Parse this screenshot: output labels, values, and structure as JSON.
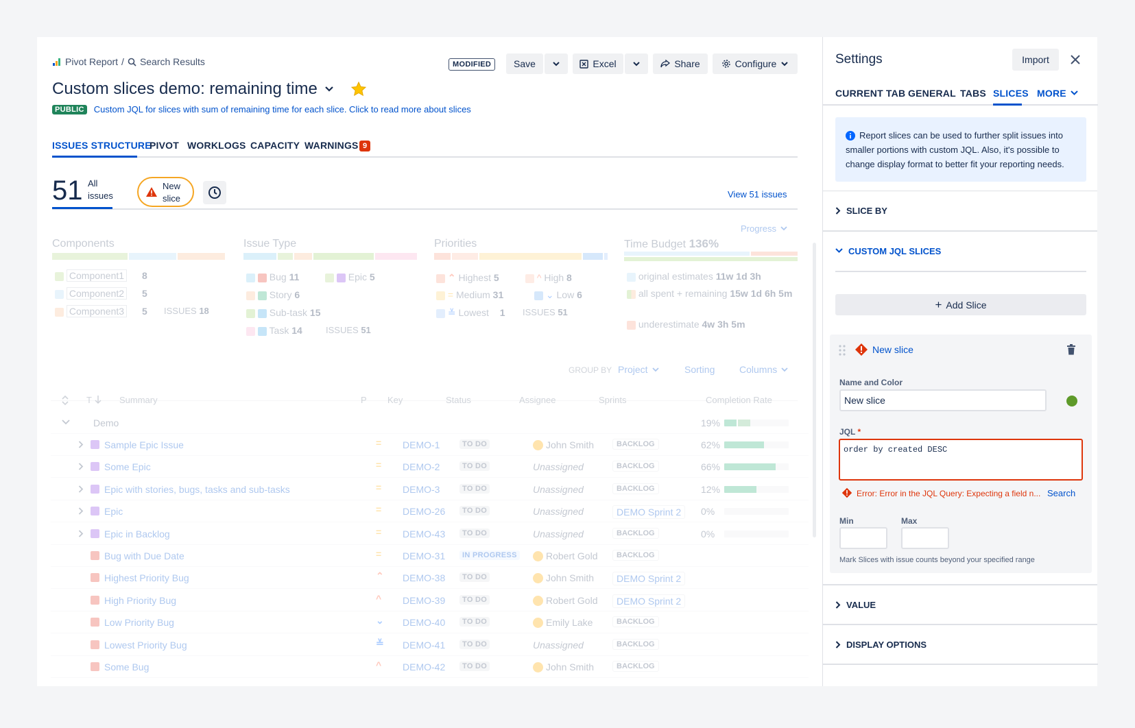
{
  "header": {
    "breadcrumb_app": "Pivot Report",
    "breadcrumb_sep": "/",
    "breadcrumb_search": "Search Results",
    "modified_badge": "MODIFIED",
    "save": "Save",
    "excel": "Excel",
    "share": "Share",
    "configure": "Configure",
    "title": "Custom slices demo: remaining time",
    "public_badge": "PUBLIC",
    "description": "Custom JQL for slices with sum of remaining time for each slice. Click to read more about slices"
  },
  "tabs": [
    {
      "label": "ISSUES STRUCTURE",
      "active": true
    },
    {
      "label": "PIVOT"
    },
    {
      "label": "WORKLOGS"
    },
    {
      "label": "CAPACITY"
    },
    {
      "label": "WARNINGS",
      "badge": "9"
    }
  ],
  "slices_bar": {
    "count": "51",
    "all_label_1": "All",
    "all_label_2": "issues",
    "new_slice_1": "New",
    "new_slice_2": "slice",
    "view_issues": "View 51 issues"
  },
  "widgets": {
    "progress_label": "Progress",
    "components": {
      "title": "Components",
      "items": [
        {
          "name": "Component1",
          "count": "8",
          "color": "#e3f2c8"
        },
        {
          "name": "Component2",
          "count": "5",
          "color": "#def0fb"
        },
        {
          "name": "Component3",
          "count": "5",
          "color": "#fde3d0"
        }
      ],
      "issues_label": "ISSUES",
      "issues_count": "18"
    },
    "issue_type": {
      "title": "Issue Type",
      "items": [
        {
          "name": "Bug",
          "count": "11"
        },
        {
          "name": "Epic",
          "count": "5"
        },
        {
          "name": "Story",
          "count": "6"
        },
        {
          "name": "Sub-task",
          "count": "15"
        },
        {
          "name": "Task",
          "count": "14"
        }
      ],
      "issues_label": "ISSUES",
      "issues_count": "51"
    },
    "priorities": {
      "title": "Priorities",
      "items": [
        {
          "name": "Highest",
          "count": "5"
        },
        {
          "name": "High",
          "count": "8"
        },
        {
          "name": "Medium",
          "count": "31"
        },
        {
          "name": "Low",
          "count": "6"
        },
        {
          "name": "Lowest",
          "count": "1"
        }
      ],
      "issues_label": "ISSUES",
      "issues_count": "51"
    },
    "time_budget": {
      "title": "Time Budget",
      "percent": "136%",
      "original_label": "original estimates",
      "original_value": "11w 1d 3h",
      "spent_label": "all spent + remaining",
      "spent_value": "15w 1d 6h 5m",
      "under_label": "underestimate",
      "under_value": "4w 3h 5m"
    }
  },
  "table_controls": {
    "group_by_label": "GROUP BY",
    "group_by_value": "Project",
    "sorting": "Sorting",
    "columns": "Columns"
  },
  "columns": {
    "t": "T",
    "summary": "Summary",
    "p": "P",
    "key": "Key",
    "status": "Status",
    "assignee": "Assignee",
    "sprints": "Sprints",
    "completion": "Completion Rate"
  },
  "group_row": {
    "name": "Demo",
    "rate": "19%",
    "progress": 0.38
  },
  "rows": [
    {
      "summary": "Sample Epic Issue",
      "key": "DEMO-1",
      "status": "TO DO",
      "assignee": "John Smith",
      "sprint": "BACKLOG",
      "rate": "62%",
      "progress": 0.62,
      "expandable": true,
      "type": "epic",
      "prio": "medium"
    },
    {
      "summary": "Some Epic",
      "key": "DEMO-2",
      "status": "TO DO",
      "assignee": "Unassigned",
      "sprint": "BACKLOG",
      "rate": "66%",
      "progress": 0.8,
      "expandable": true,
      "type": "epic",
      "prio": "medium"
    },
    {
      "summary": "Epic with stories, bugs, tasks and sub-tasks",
      "key": "DEMO-3",
      "status": "TO DO",
      "assignee": "Unassigned",
      "sprint": "BACKLOG",
      "rate": "12%",
      "progress": 0.5,
      "expandable": true,
      "type": "epic",
      "prio": "medium"
    },
    {
      "summary": "Epic",
      "key": "DEMO-26",
      "status": "TO DO",
      "assignee": "Unassigned",
      "sprint": "DEMO Sprint 2",
      "rate": "0%",
      "progress": 0,
      "expandable": true,
      "type": "epic",
      "prio": "medium"
    },
    {
      "summary": "Epic in Backlog",
      "key": "DEMO-43",
      "status": "TO DO",
      "assignee": "Unassigned",
      "sprint": "BACKLOG",
      "rate": "0%",
      "progress": 0,
      "expandable": true,
      "type": "epic",
      "prio": "medium"
    },
    {
      "summary": "Bug with Due Date",
      "key": "DEMO-31",
      "status": "IN PROGRESS",
      "assignee": "Robert Gold",
      "sprint": "BACKLOG",
      "rate": "",
      "expandable": false,
      "type": "bug",
      "prio": "medium"
    },
    {
      "summary": "Highest Priority Bug",
      "key": "DEMO-38",
      "status": "TO DO",
      "assignee": "John Smith",
      "sprint": "DEMO Sprint 2",
      "rate": "",
      "expandable": false,
      "type": "bug",
      "prio": "highest"
    },
    {
      "summary": "High Priority Bug",
      "key": "DEMO-39",
      "status": "TO DO",
      "assignee": "Robert Gold",
      "sprint": "DEMO Sprint 2",
      "rate": "",
      "expandable": false,
      "type": "bug",
      "prio": "high"
    },
    {
      "summary": "Low Priority Bug",
      "key": "DEMO-40",
      "status": "TO DO",
      "assignee": "Emily Lake",
      "sprint": "BACKLOG",
      "rate": "",
      "expandable": false,
      "type": "bug",
      "prio": "low"
    },
    {
      "summary": "Lowest Priority Bug",
      "key": "DEMO-41",
      "status": "TO DO",
      "assignee": "Unassigned",
      "sprint": "BACKLOG",
      "rate": "",
      "expandable": false,
      "type": "bug",
      "prio": "lowest"
    },
    {
      "summary": "Some Bug",
      "key": "DEMO-42",
      "status": "TO DO",
      "assignee": "John Smith",
      "sprint": "BACKLOG",
      "rate": "",
      "expandable": false,
      "type": "bug",
      "prio": "high"
    }
  ],
  "settings": {
    "title": "Settings",
    "import": "Import",
    "tabs": [
      {
        "label": "CURRENT TAB"
      },
      {
        "label": "GENERAL"
      },
      {
        "label": "TABS"
      },
      {
        "label": "SLICES",
        "active": true
      },
      {
        "label": "MORE"
      }
    ],
    "info": "Report slices can be used to further split issues into smaller portions with custom JQL. Also, it's possible to change display format to better fit your reporting needs.",
    "slice_by": "SLICE BY",
    "custom_jql": "CUSTOM JQL SLICES",
    "add_slice": "Add Slice",
    "slice_name": "New slice",
    "name_color_label": "Name and Color",
    "name_value": "New slice",
    "jql_label": "JQL",
    "jql_value": "order by created DESC",
    "error": "Error: Error in the JQL Query: Expecting a field n...",
    "search": "Search",
    "min_label": "Min",
    "max_label": "Max",
    "hint": "Mark Slices with issue counts beyond your specified range",
    "value": "VALUE",
    "display_options": "DISPLAY OPTIONS",
    "slice_color": "#5e9a2a"
  },
  "colors": {
    "accent": "#0052cc",
    "error": "#de350b",
    "warning": "#f5a623",
    "public": "#1f845a"
  }
}
